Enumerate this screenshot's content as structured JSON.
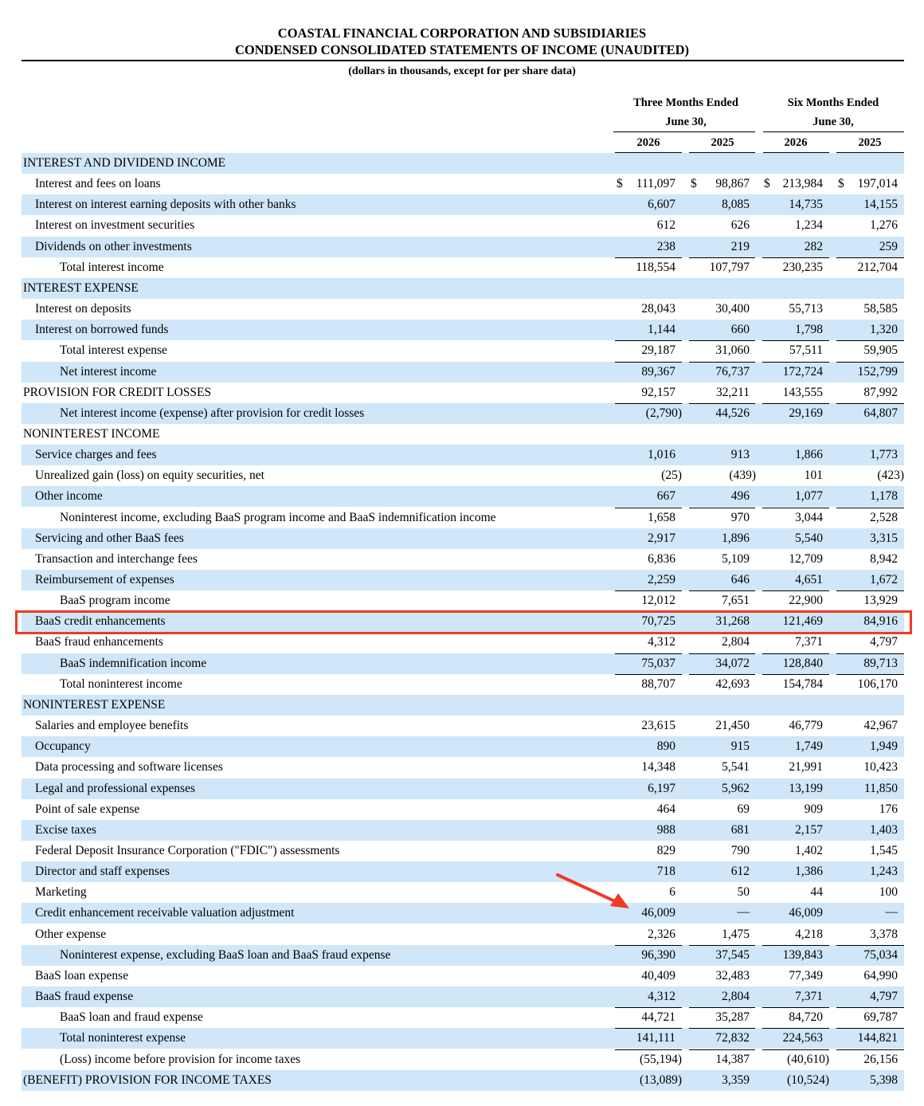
{
  "header": {
    "company": "COASTAL FINANCIAL CORPORATION AND SUBSIDIARIES",
    "statement": "CONDENSED CONSOLIDATED STATEMENTS OF INCOME (UNAUDITED)",
    "units": "(dollars in thousands, except for per share data)"
  },
  "columns": {
    "group1_line1": "Three Months Ended",
    "group1_line2": "June 30,",
    "group2_line1": "Six Months Ended",
    "group2_line2": "June 30,",
    "years": [
      "2026",
      "2025",
      "2026",
      "2025"
    ]
  },
  "colors": {
    "shade": "#cfe7f8",
    "highlight": "#ee3b24"
  },
  "rows": [
    {
      "label": "INTEREST AND DIVIDEND INCOME",
      "indent": 0,
      "values": []
    },
    {
      "label": "Interest and fees on loans",
      "indent": 1,
      "values": [
        "111,097",
        "98,867",
        "213,984",
        "197,014"
      ],
      "currency": true
    },
    {
      "label": "Interest on interest earning deposits with other banks",
      "indent": 1,
      "values": [
        "6,607",
        "8,085",
        "14,735",
        "14,155"
      ]
    },
    {
      "label": "Interest on investment securities",
      "indent": 1,
      "values": [
        "612",
        "626",
        "1,234",
        "1,276"
      ]
    },
    {
      "label": "Dividends on other investments",
      "indent": 1,
      "values": [
        "238",
        "219",
        "282",
        "259"
      ]
    },
    {
      "label": "Total interest income",
      "indent": 2,
      "values": [
        "118,554",
        "107,797",
        "230,235",
        "212,704"
      ],
      "border": true
    },
    {
      "label": "INTEREST EXPENSE",
      "indent": 0,
      "values": []
    },
    {
      "label": "Interest on deposits",
      "indent": 1,
      "values": [
        "28,043",
        "30,400",
        "55,713",
        "58,585"
      ]
    },
    {
      "label": "Interest on borrowed funds",
      "indent": 1,
      "values": [
        "1,144",
        "660",
        "1,798",
        "1,320"
      ]
    },
    {
      "label": "Total interest expense",
      "indent": 2,
      "values": [
        "29,187",
        "31,060",
        "57,511",
        "59,905"
      ],
      "border": true
    },
    {
      "label": "Net interest income",
      "indent": 2,
      "values": [
        "89,367",
        "76,737",
        "172,724",
        "152,799"
      ],
      "border": true
    },
    {
      "label": "PROVISION FOR CREDIT LOSSES",
      "indent": 0,
      "values": [
        "92,157",
        "32,211",
        "143,555",
        "87,992"
      ]
    },
    {
      "label": "Net interest income (expense) after provision for credit losses",
      "indent": 2,
      "values": [
        "(2,790)",
        "44,526",
        "29,169",
        "64,807"
      ],
      "border": true
    },
    {
      "label": "NONINTEREST INCOME",
      "indent": 0,
      "values": []
    },
    {
      "label": "Service charges and fees",
      "indent": 1,
      "values": [
        "1,016",
        "913",
        "1,866",
        "1,773"
      ]
    },
    {
      "label": "Unrealized gain (loss) on equity securities, net",
      "indent": 1,
      "values": [
        "(25)",
        "(439)",
        "101",
        "(423)"
      ]
    },
    {
      "label": "Other income",
      "indent": 1,
      "values": [
        "667",
        "496",
        "1,077",
        "1,178"
      ]
    },
    {
      "label": "Noninterest income, excluding BaaS program income and BaaS indemnification income",
      "indent": 2,
      "values": [
        "1,658",
        "970",
        "3,044",
        "2,528"
      ],
      "border": true
    },
    {
      "label": "Servicing and other BaaS fees",
      "indent": 1,
      "values": [
        "2,917",
        "1,896",
        "5,540",
        "3,315"
      ]
    },
    {
      "label": "Transaction and interchange fees",
      "indent": 1,
      "values": [
        "6,836",
        "5,109",
        "12,709",
        "8,942"
      ]
    },
    {
      "label": "Reimbursement of expenses",
      "indent": 1,
      "values": [
        "2,259",
        "646",
        "4,651",
        "1,672"
      ]
    },
    {
      "label": "BaaS program income",
      "indent": 2,
      "values": [
        "12,012",
        "7,651",
        "22,900",
        "13,929"
      ],
      "border": true
    },
    {
      "label": "BaaS credit enhancements",
      "indent": 1,
      "values": [
        "70,725",
        "31,268",
        "121,469",
        "84,916"
      ],
      "highlight": true
    },
    {
      "label": "BaaS fraud enhancements",
      "indent": 1,
      "values": [
        "4,312",
        "2,804",
        "7,371",
        "4,797"
      ]
    },
    {
      "label": "BaaS indemnification income",
      "indent": 2,
      "values": [
        "75,037",
        "34,072",
        "128,840",
        "89,713"
      ],
      "border": true
    },
    {
      "label": "Total noninterest income",
      "indent": 2,
      "values": [
        "88,707",
        "42,693",
        "154,784",
        "106,170"
      ],
      "border": true
    },
    {
      "label": "NONINTEREST EXPENSE",
      "indent": 0,
      "values": []
    },
    {
      "label": "Salaries and employee benefits",
      "indent": 1,
      "values": [
        "23,615",
        "21,450",
        "46,779",
        "42,967"
      ]
    },
    {
      "label": "Occupancy",
      "indent": 1,
      "values": [
        "890",
        "915",
        "1,749",
        "1,949"
      ]
    },
    {
      "label": "Data processing and software licenses",
      "indent": 1,
      "values": [
        "14,348",
        "5,541",
        "21,991",
        "10,423"
      ]
    },
    {
      "label": "Legal and professional expenses",
      "indent": 1,
      "values": [
        "6,197",
        "5,962",
        "13,199",
        "11,850"
      ]
    },
    {
      "label": "Point of sale expense",
      "indent": 1,
      "values": [
        "464",
        "69",
        "909",
        "176"
      ]
    },
    {
      "label": "Excise taxes",
      "indent": 1,
      "values": [
        "988",
        "681",
        "2,157",
        "1,403"
      ]
    },
    {
      "label": "Federal Deposit Insurance Corporation (\"FDIC\") assessments",
      "indent": 1,
      "values": [
        "829",
        "790",
        "1,402",
        "1,545"
      ]
    },
    {
      "label": "Director and staff expenses",
      "indent": 1,
      "values": [
        "718",
        "612",
        "1,386",
        "1,243"
      ]
    },
    {
      "label": "Marketing",
      "indent": 1,
      "values": [
        "6",
        "50",
        "44",
        "100"
      ]
    },
    {
      "label": "Credit enhancement receivable valuation adjustment",
      "indent": 1,
      "values": [
        "46,009",
        "—",
        "46,009",
        "—"
      ]
    },
    {
      "label": "Other expense",
      "indent": 1,
      "values": [
        "2,326",
        "1,475",
        "4,218",
        "3,378"
      ]
    },
    {
      "label": "Noninterest expense, excluding BaaS loan and BaaS fraud expense",
      "indent": 2,
      "values": [
        "96,390",
        "37,545",
        "139,843",
        "75,034"
      ],
      "border": true
    },
    {
      "label": "BaaS loan expense",
      "indent": 1,
      "values": [
        "40,409",
        "32,483",
        "77,349",
        "64,990"
      ]
    },
    {
      "label": "BaaS fraud expense",
      "indent": 1,
      "values": [
        "4,312",
        "2,804",
        "7,371",
        "4,797"
      ]
    },
    {
      "label": "BaaS loan and fraud expense",
      "indent": 2,
      "values": [
        "44,721",
        "35,287",
        "84,720",
        "69,787"
      ],
      "border": true
    },
    {
      "label": "Total noninterest expense",
      "indent": 2,
      "values": [
        "141,111",
        "72,832",
        "224,563",
        "144,821"
      ],
      "border": true
    },
    {
      "label": "(Loss) income before provision for income taxes",
      "indent": 2,
      "values": [
        "(55,194)",
        "14,387",
        "(40,610)",
        "26,156"
      ],
      "border": true
    },
    {
      "label": "(BENEFIT) PROVISION FOR INCOME TAXES",
      "indent": 0,
      "values": [
        "(13,089)",
        "3,359",
        "(10,524)",
        "5,398"
      ]
    }
  ]
}
